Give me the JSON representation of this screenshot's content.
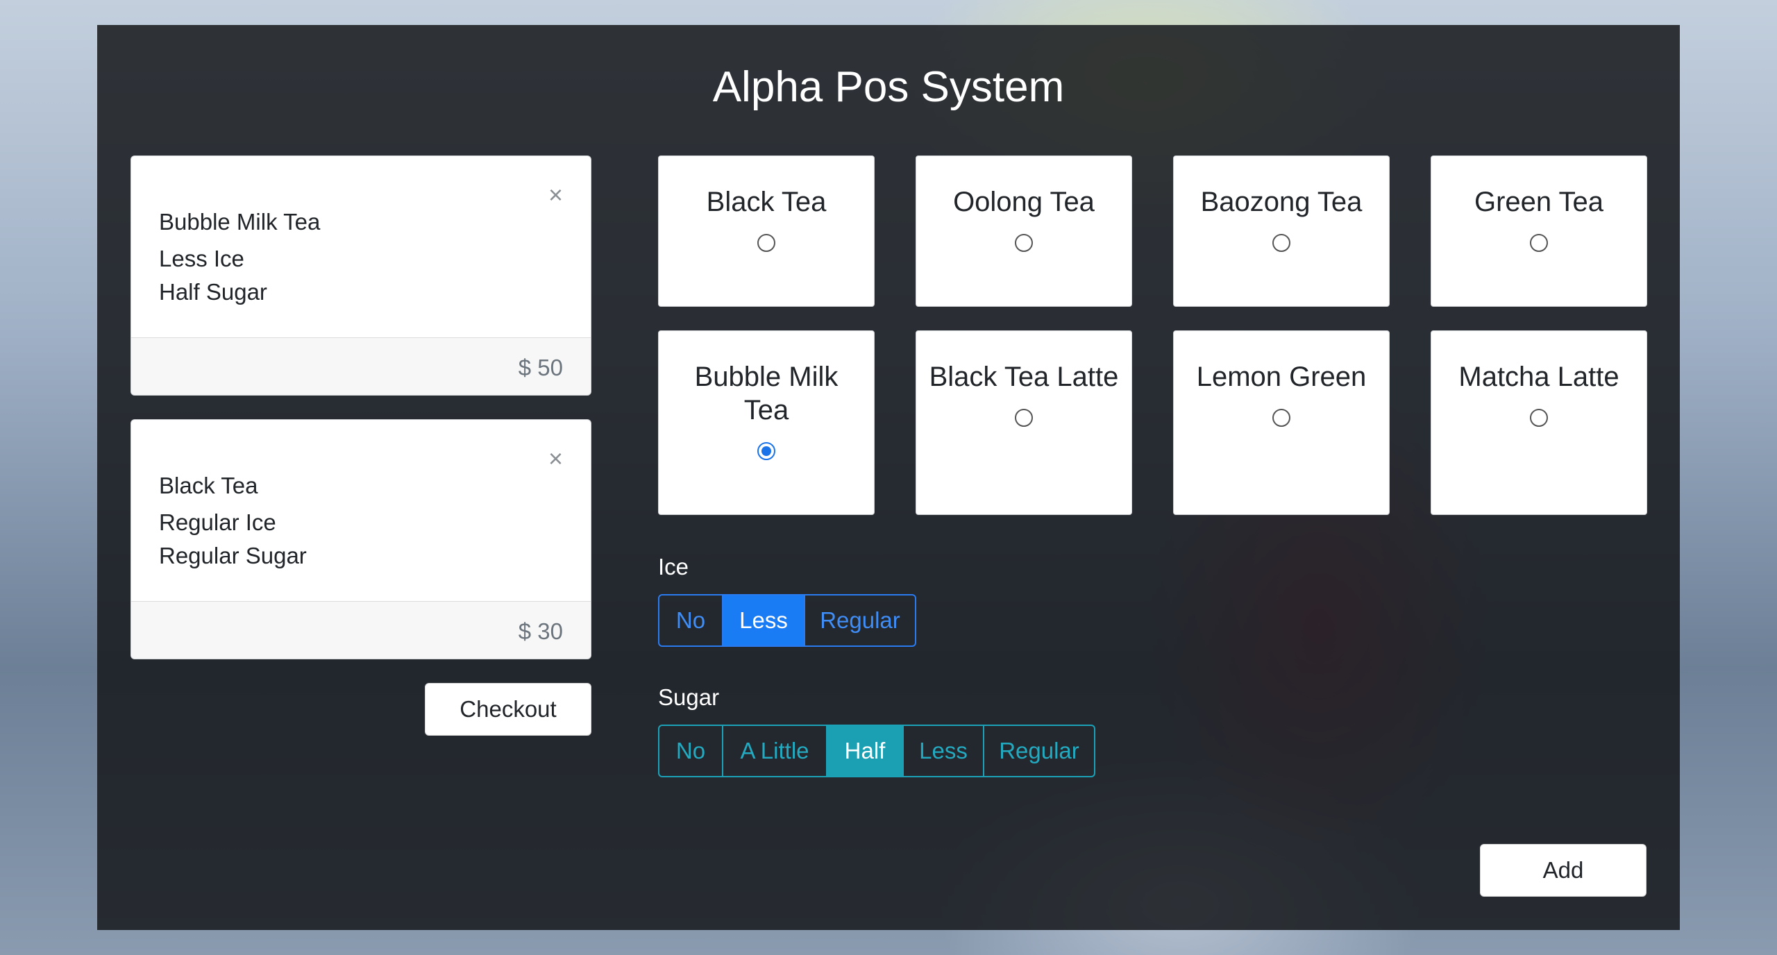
{
  "title": "Alpha Pos System",
  "orders": [
    {
      "name": "Bubble Milk Tea",
      "ice": "Less Ice",
      "sugar": "Half Sugar",
      "price": "$ 50",
      "close": "×"
    },
    {
      "name": "Black Tea",
      "ice": "Regular Ice",
      "sugar": "Regular Sugar",
      "price": "$ 30",
      "close": "×"
    }
  ],
  "checkout_label": "Checkout",
  "add_label": "Add",
  "teas": [
    {
      "name": "Black Tea",
      "selected": false
    },
    {
      "name": "Oolong Tea",
      "selected": false
    },
    {
      "name": "Baozong Tea",
      "selected": false
    },
    {
      "name": "Green Tea",
      "selected": false
    },
    {
      "name": "Bubble Milk Tea",
      "selected": true
    },
    {
      "name": "Black Tea Latte",
      "selected": false
    },
    {
      "name": "Lemon Green",
      "selected": false
    },
    {
      "name": "Matcha Latte",
      "selected": false
    }
  ],
  "ice": {
    "label": "Ice",
    "options": [
      "No",
      "Less",
      "Regular"
    ],
    "selected": "Less"
  },
  "sugar": {
    "label": "Sugar",
    "options": [
      "No",
      "A Little",
      "Half",
      "Less",
      "Regular"
    ],
    "selected": "Half"
  },
  "colors": {
    "primary": "#1a7cf5",
    "info": "#1b9fb3"
  }
}
